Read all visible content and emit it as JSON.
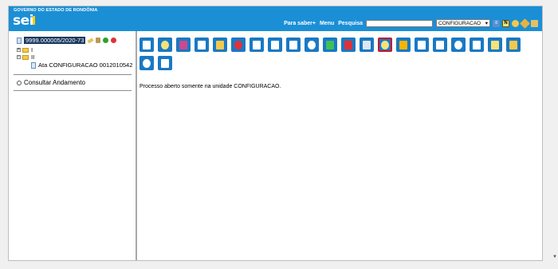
{
  "header": {
    "org": "GOVERNO DO ESTADO DE RONDÔNIA",
    "logo": "sei",
    "nav": {
      "para_saber": "Para saber+",
      "menu": "Menu",
      "pesquisa": "Pesquisa"
    },
    "search_value": "",
    "unit": "CONFIGURACAO",
    "icons": [
      "list-icon",
      "n-badge-icon",
      "user-icon",
      "tools-icon",
      "exit-icon"
    ]
  },
  "tree": {
    "process": "9999.000005/2020-73",
    "folder_1": "I",
    "folder_2": "II",
    "document": "Ata CONFIGURACAO 0012010542",
    "consultar": "Consultar Andamento"
  },
  "toolbar": {
    "selected_index": 13,
    "buttons": [
      "incluir-documento",
      "iniciar-processo-relacionado",
      "gerenciar-acompanhamento",
      "acompanhamento-especial",
      "ciencia",
      "enviar-processo",
      "atualizar-andamento",
      "atribuir-processo",
      "relacionar-processos",
      "enviar-email",
      "duplicar-processo",
      "anexar-processo",
      "ordenar-arvore",
      "gerenciar-marcador",
      "sobrestar-processo",
      "anotacoes",
      "concluir-processo",
      "gerar-pdf",
      "gerar-zip",
      "acompanhamento",
      "marcador",
      "listar-processos",
      "pesquisar-processo"
    ]
  },
  "status_message": "Processo aberto somente na unidade CONFIGURACAO."
}
